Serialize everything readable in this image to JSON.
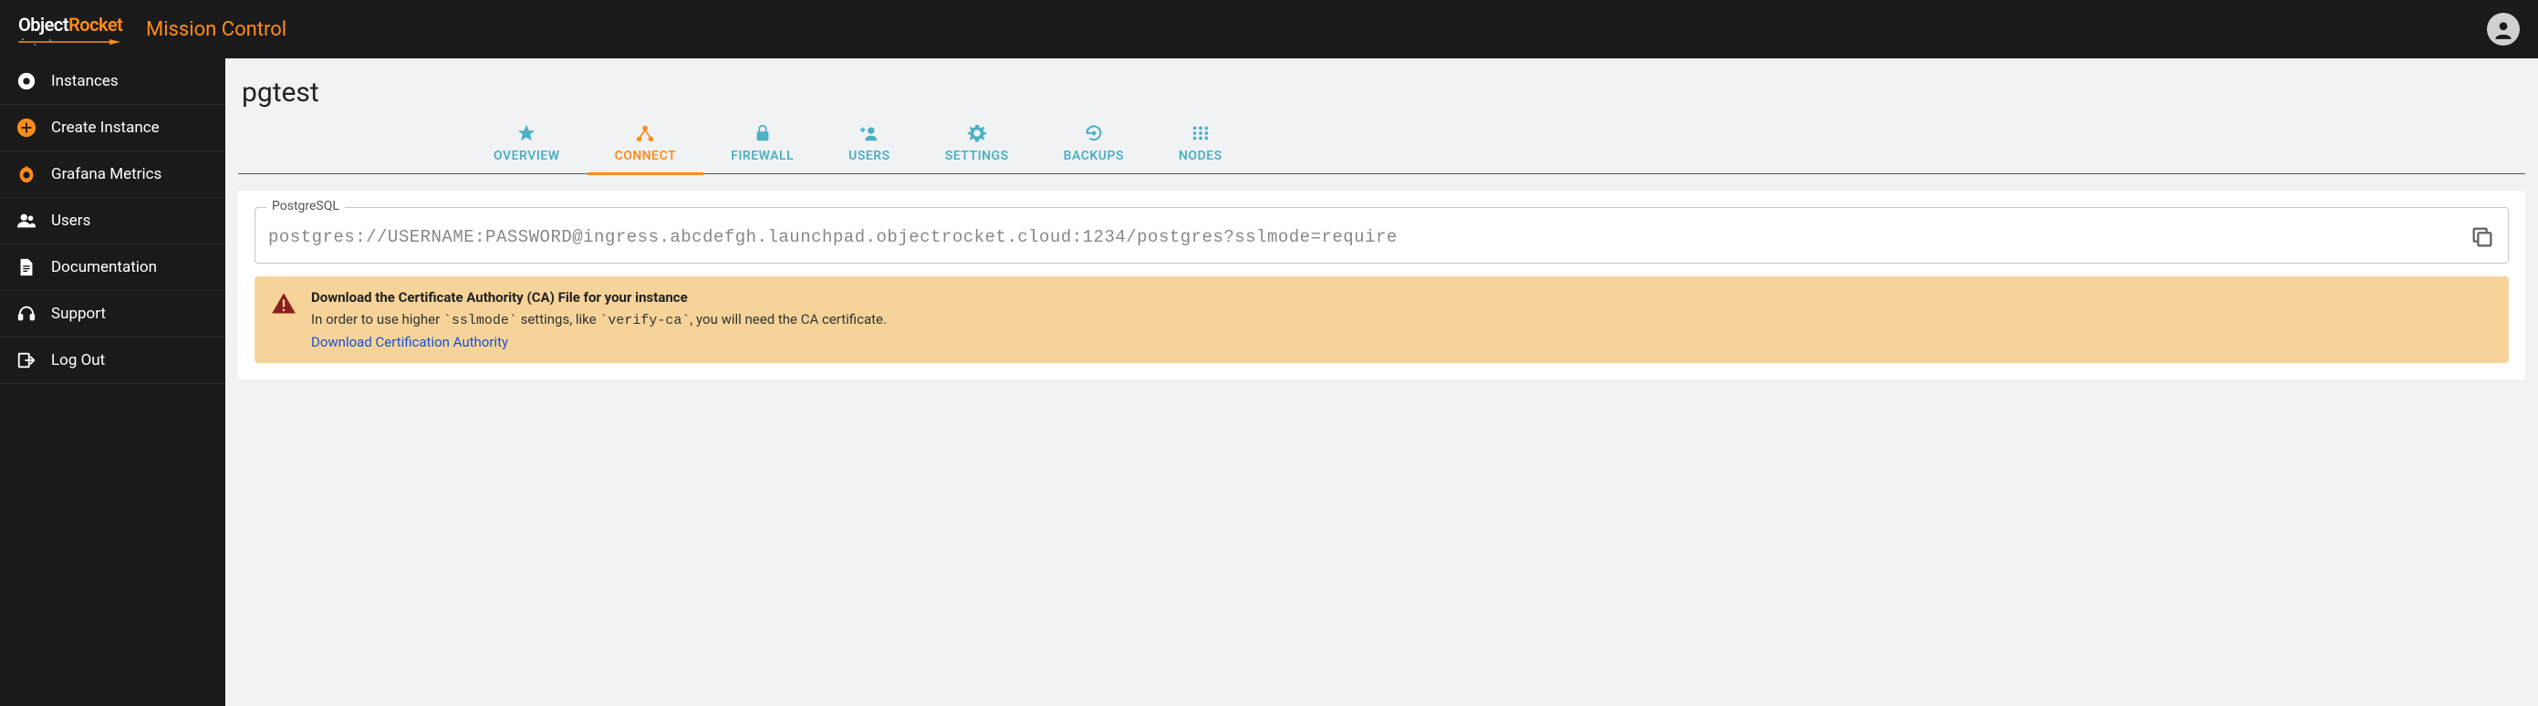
{
  "brand": {
    "part1": "Object",
    "part2": "Rocket"
  },
  "app_title": "Mission Control",
  "sidebar": {
    "items": [
      {
        "label": "Instances"
      },
      {
        "label": "Create Instance"
      },
      {
        "label": "Grafana Metrics"
      },
      {
        "label": "Users"
      },
      {
        "label": "Documentation"
      },
      {
        "label": "Support"
      },
      {
        "label": "Log Out"
      }
    ]
  },
  "page": {
    "title": "pgtest"
  },
  "tabs": [
    {
      "label": "OVERVIEW"
    },
    {
      "label": "CONNECT"
    },
    {
      "label": "FIREWALL"
    },
    {
      "label": "USERS"
    },
    {
      "label": "SETTINGS"
    },
    {
      "label": "BACKUPS"
    },
    {
      "label": "NODES"
    }
  ],
  "active_tab_index": 1,
  "connect": {
    "legend": "PostgreSQL",
    "connection_string": "postgres://USERNAME:PASSWORD@ingress.abcdefgh.launchpad.objectrocket.cloud:1234/postgres?sslmode=require"
  },
  "alert": {
    "title": "Download the Certificate Authority (CA) File for your instance",
    "text_pre": "In order to use higher ",
    "text_code1": "`sslmode`",
    "text_mid": " settings, like ",
    "text_code2": "`verify-ca`",
    "text_post": ", you will need the CA certificate.",
    "link": "Download Certification Authority"
  },
  "colors": {
    "accent": "#ff8c1a",
    "tab_inactive": "#4db0c4",
    "alert_bg": "#f6d499",
    "alert_icon": "#8a1e1e",
    "link": "#1a4ed8"
  }
}
